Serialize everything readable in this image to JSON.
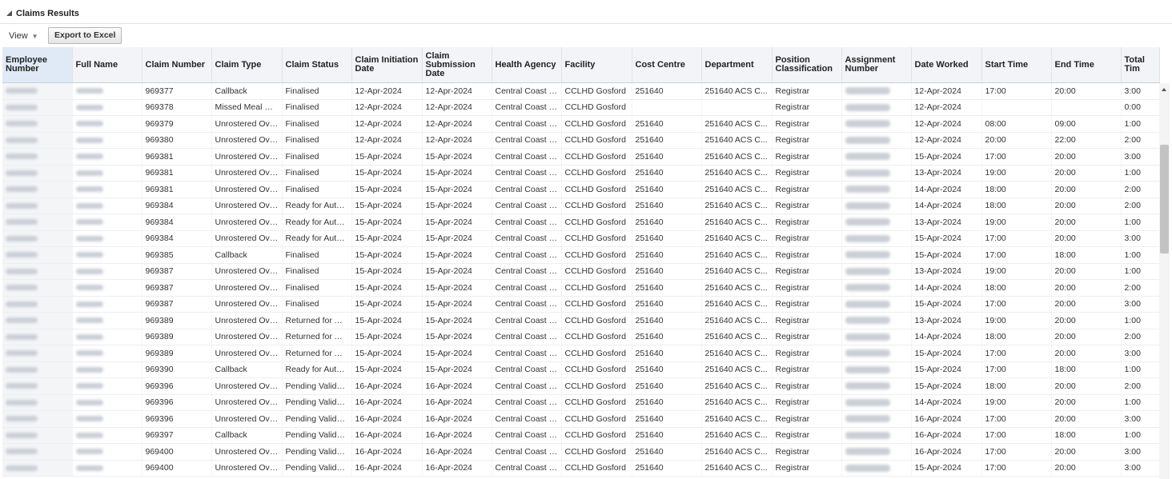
{
  "section": {
    "title": "Claims Results"
  },
  "toolbar": {
    "view_label": "View",
    "export_label": "Export to Excel"
  },
  "table": {
    "headers": [
      "Employee Number",
      "Full Name",
      "Claim Number",
      "Claim Type",
      "Claim Status",
      "Claim Initiation Date",
      "Claim Submission Date",
      "Health Agency",
      "Facility",
      "Cost Centre",
      "Department",
      "Position Classification",
      "Assignment Number",
      "Date Worked",
      "Start Time",
      "End Time",
      "Total Tim"
    ],
    "rows": [
      [
        "",
        "",
        "969377",
        "Callback",
        "Finalised",
        "12-Apr-2024",
        "12-Apr-2024",
        "Central Coast L...",
        "CCLHD Gosford",
        "251640",
        "251640 ACS C...",
        "Registrar",
        "",
        "12-Apr-2024",
        "17:00",
        "20:00",
        "3:00"
      ],
      [
        "",
        "",
        "969378",
        "Missed Meal Br...",
        "Finalised",
        "12-Apr-2024",
        "12-Apr-2024",
        "Central Coast L...",
        "CCLHD Gosford",
        "",
        "",
        "Registrar",
        "",
        "12-Apr-2024",
        "",
        "",
        "0:00"
      ],
      [
        "",
        "",
        "969379",
        "Unrostered Ove...",
        "Finalised",
        "12-Apr-2024",
        "12-Apr-2024",
        "Central Coast L...",
        "CCLHD Gosford",
        "251640",
        "251640 ACS C...",
        "Registrar",
        "",
        "12-Apr-2024",
        "08:00",
        "09:00",
        "1:00"
      ],
      [
        "",
        "",
        "969380",
        "Unrostered Ove...",
        "Finalised",
        "12-Apr-2024",
        "12-Apr-2024",
        "Central Coast L...",
        "CCLHD Gosford",
        "251640",
        "251640 ACS C...",
        "Registrar",
        "",
        "12-Apr-2024",
        "20:00",
        "22:00",
        "2:00"
      ],
      [
        "",
        "",
        "969381",
        "Unrostered Ove...",
        "Finalised",
        "15-Apr-2024",
        "15-Apr-2024",
        "Central Coast L...",
        "CCLHD Gosford",
        "251640",
        "251640 ACS C...",
        "Registrar",
        "",
        "15-Apr-2024",
        "17:00",
        "20:00",
        "3:00"
      ],
      [
        "",
        "",
        "969381",
        "Unrostered Ove...",
        "Finalised",
        "15-Apr-2024",
        "15-Apr-2024",
        "Central Coast L...",
        "CCLHD Gosford",
        "251640",
        "251640 ACS C...",
        "Registrar",
        "",
        "13-Apr-2024",
        "19:00",
        "20:00",
        "1:00"
      ],
      [
        "",
        "",
        "969381",
        "Unrostered Ove...",
        "Finalised",
        "15-Apr-2024",
        "15-Apr-2024",
        "Central Coast L...",
        "CCLHD Gosford",
        "251640",
        "251640 ACS C...",
        "Registrar",
        "",
        "14-Apr-2024",
        "18:00",
        "20:00",
        "2:00"
      ],
      [
        "",
        "",
        "969384",
        "Unrostered Ove...",
        "Ready for Auto...",
        "15-Apr-2024",
        "15-Apr-2024",
        "Central Coast L...",
        "CCLHD Gosford",
        "251640",
        "251640 ACS C...",
        "Registrar",
        "",
        "14-Apr-2024",
        "18:00",
        "20:00",
        "2:00"
      ],
      [
        "",
        "",
        "969384",
        "Unrostered Ove...",
        "Ready for Auto...",
        "15-Apr-2024",
        "15-Apr-2024",
        "Central Coast L...",
        "CCLHD Gosford",
        "251640",
        "251640 ACS C...",
        "Registrar",
        "",
        "13-Apr-2024",
        "19:00",
        "20:00",
        "1:00"
      ],
      [
        "",
        "",
        "969384",
        "Unrostered Ove...",
        "Ready for Auto...",
        "15-Apr-2024",
        "15-Apr-2024",
        "Central Coast L...",
        "CCLHD Gosford",
        "251640",
        "251640 ACS C...",
        "Registrar",
        "",
        "15-Apr-2024",
        "17:00",
        "20:00",
        "3:00"
      ],
      [
        "",
        "",
        "969385",
        "Callback",
        "Finalised",
        "15-Apr-2024",
        "15-Apr-2024",
        "Central Coast L...",
        "CCLHD Gosford",
        "251640",
        "251640 ACS C...",
        "Registrar",
        "",
        "15-Apr-2024",
        "17:00",
        "18:00",
        "1:00"
      ],
      [
        "",
        "",
        "969387",
        "Unrostered Ove...",
        "Finalised",
        "15-Apr-2024",
        "15-Apr-2024",
        "Central Coast L...",
        "CCLHD Gosford",
        "251640",
        "251640 ACS C...",
        "Registrar",
        "",
        "13-Apr-2024",
        "19:00",
        "20:00",
        "1:00"
      ],
      [
        "",
        "",
        "969387",
        "Unrostered Ove...",
        "Finalised",
        "15-Apr-2024",
        "15-Apr-2024",
        "Central Coast L...",
        "CCLHD Gosford",
        "251640",
        "251640 ACS C...",
        "Registrar",
        "",
        "14-Apr-2024",
        "18:00",
        "20:00",
        "2:00"
      ],
      [
        "",
        "",
        "969387",
        "Unrostered Ove...",
        "Finalised",
        "15-Apr-2024",
        "15-Apr-2024",
        "Central Coast L...",
        "CCLHD Gosford",
        "251640",
        "251640 ACS C...",
        "Registrar",
        "",
        "15-Apr-2024",
        "17:00",
        "20:00",
        "3:00"
      ],
      [
        "",
        "",
        "969389",
        "Unrostered Ove...",
        "Returned for Am...",
        "15-Apr-2024",
        "15-Apr-2024",
        "Central Coast L...",
        "CCLHD Gosford",
        "251640",
        "251640 ACS C...",
        "Registrar",
        "",
        "13-Apr-2024",
        "19:00",
        "20:00",
        "1:00"
      ],
      [
        "",
        "",
        "969389",
        "Unrostered Ove...",
        "Returned for Am...",
        "15-Apr-2024",
        "15-Apr-2024",
        "Central Coast L...",
        "CCLHD Gosford",
        "251640",
        "251640 ACS C...",
        "Registrar",
        "",
        "14-Apr-2024",
        "18:00",
        "20:00",
        "2:00"
      ],
      [
        "",
        "",
        "969389",
        "Unrostered Ove...",
        "Returned for Am...",
        "15-Apr-2024",
        "15-Apr-2024",
        "Central Coast L...",
        "CCLHD Gosford",
        "251640",
        "251640 ACS C...",
        "Registrar",
        "",
        "15-Apr-2024",
        "17:00",
        "20:00",
        "3:00"
      ],
      [
        "",
        "",
        "969390",
        "Callback",
        "Ready for Auto...",
        "15-Apr-2024",
        "15-Apr-2024",
        "Central Coast L...",
        "CCLHD Gosford",
        "251640",
        "251640 ACS C...",
        "Registrar",
        "",
        "15-Apr-2024",
        "17:00",
        "18:00",
        "1:00"
      ],
      [
        "",
        "",
        "969396",
        "Unrostered Ove...",
        "Pending Validation",
        "16-Apr-2024",
        "16-Apr-2024",
        "Central Coast L...",
        "CCLHD Gosford",
        "251640",
        "251640 ACS C...",
        "Registrar",
        "",
        "15-Apr-2024",
        "18:00",
        "20:00",
        "2:00"
      ],
      [
        "",
        "",
        "969396",
        "Unrostered Ove...",
        "Pending Validation",
        "16-Apr-2024",
        "16-Apr-2024",
        "Central Coast L...",
        "CCLHD Gosford",
        "251640",
        "251640 ACS C...",
        "Registrar",
        "",
        "14-Apr-2024",
        "19:00",
        "20:00",
        "1:00"
      ],
      [
        "",
        "",
        "969396",
        "Unrostered Ove...",
        "Pending Validation",
        "16-Apr-2024",
        "16-Apr-2024",
        "Central Coast L...",
        "CCLHD Gosford",
        "251640",
        "251640 ACS C...",
        "Registrar",
        "",
        "16-Apr-2024",
        "17:00",
        "20:00",
        "3:00"
      ],
      [
        "",
        "",
        "969397",
        "Callback",
        "Pending Validation",
        "16-Apr-2024",
        "16-Apr-2024",
        "Central Coast L...",
        "CCLHD Gosford",
        "251640",
        "251640 ACS C...",
        "Registrar",
        "",
        "16-Apr-2024",
        "17:00",
        "18:00",
        "1:00"
      ],
      [
        "",
        "",
        "969400",
        "Unrostered Ove...",
        "Pending Validation",
        "16-Apr-2024",
        "16-Apr-2024",
        "Central Coast L...",
        "CCLHD Gosford",
        "251640",
        "251640 ACS C...",
        "Registrar",
        "",
        "16-Apr-2024",
        "17:00",
        "20:00",
        "3:00"
      ],
      [
        "",
        "",
        "969400",
        "Unrostered Ove...",
        "Pending Validation",
        "16-Apr-2024",
        "16-Apr-2024",
        "Central Coast L...",
        "CCLHD Gosford",
        "251640",
        "251640 ACS C...",
        "Registrar",
        "",
        "15-Apr-2024",
        "17:00",
        "20:00",
        "3:00"
      ]
    ]
  }
}
